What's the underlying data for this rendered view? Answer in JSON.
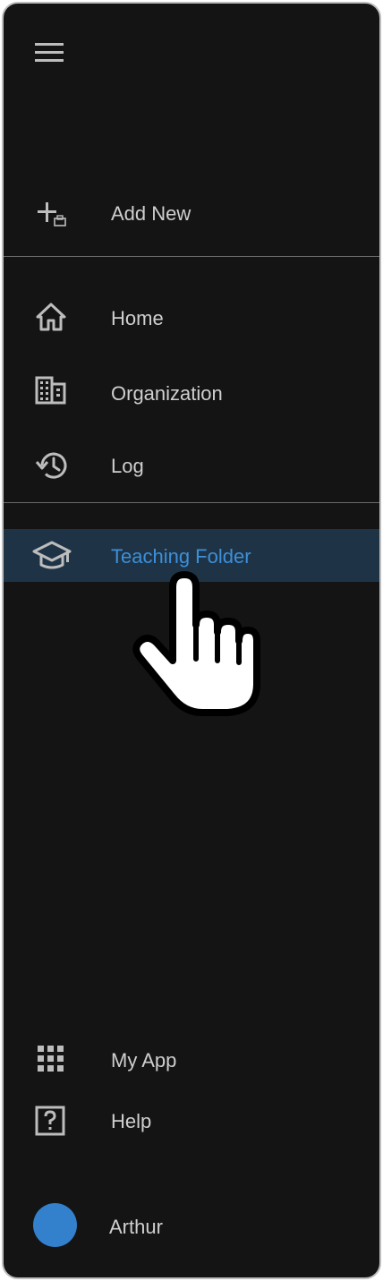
{
  "nav": {
    "add_new": "Add New",
    "home": "Home",
    "organization": "Organization",
    "log": "Log",
    "teaching_folder": "Teaching Folder",
    "my_app": "My App",
    "help": "Help",
    "user_name": "Arthur"
  },
  "icons": {
    "menu": "menu-icon",
    "add_new": "add-icon",
    "home": "home-icon",
    "organization": "building-icon",
    "log": "history-icon",
    "teaching_folder": "graduation-cap-icon",
    "my_app": "apps-grid-icon",
    "help": "help-icon",
    "cursor": "hand-pointer-icon"
  },
  "colors": {
    "background": "#141414",
    "text": "#cfcfcf",
    "active_text": "#3d8fd9",
    "active_background": "#1e3446",
    "avatar": "#3380cc"
  },
  "state": {
    "active_item": "Teaching Folder"
  }
}
